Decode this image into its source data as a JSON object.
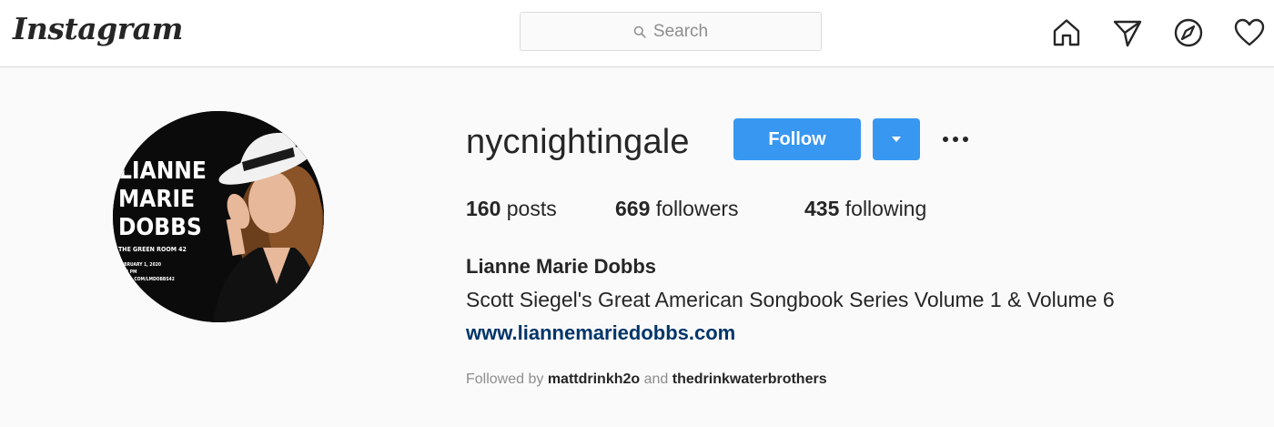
{
  "header": {
    "logo_text": "Instagram",
    "search_placeholder": "Search",
    "nav_icons": [
      "home-icon",
      "direct-message-icon",
      "explore-icon",
      "activity-heart-icon"
    ]
  },
  "profile": {
    "username": "nycnightingale",
    "follow_label": "Follow",
    "stats": {
      "posts_count": "160",
      "posts_label": "posts",
      "followers_count": "669",
      "followers_label": "followers",
      "following_count": "435",
      "following_label": "following"
    },
    "full_name": "Lianne Marie Dobbs",
    "bio": "Scott Siegel's Great American Songbook Series Volume 1 & Volume 6",
    "website": "www.liannemariedobbs.com",
    "followed_by": {
      "prefix": "Followed by",
      "user1": "mattdrinkh2o",
      "conjunction": "and",
      "user2": "thedrinkwaterbrothers"
    },
    "avatar": {
      "lines": [
        "LIANNE",
        "MARIE",
        "DOBBS"
      ],
      "venue": "THE GREEN ROOM 42",
      "date": "FEBRUARY 1, 2020",
      "time": "9:30 PM",
      "url": "TIX.LL.COM/LMDOBBS42"
    }
  },
  "colors": {
    "accent": "#3897f0",
    "link": "#003569",
    "muted": "#8e8e8e",
    "text": "#262626",
    "background": "#fafafa"
  }
}
